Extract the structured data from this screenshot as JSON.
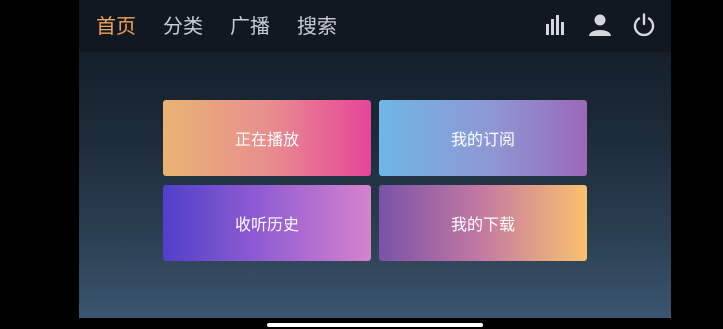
{
  "nav": {
    "tabs": [
      {
        "label": "首页",
        "active": true
      },
      {
        "label": "分类",
        "active": false
      },
      {
        "label": "广播",
        "active": false
      },
      {
        "label": "搜索",
        "active": false
      }
    ],
    "icons": [
      "bar-chart-icon",
      "user-icon",
      "power-icon"
    ]
  },
  "menu": {
    "items": [
      {
        "label": "正在播放"
      },
      {
        "label": "我的订阅"
      },
      {
        "label": "收听历史"
      },
      {
        "label": "我的下载"
      }
    ]
  },
  "colors": {
    "active_tab": "#f0a35a",
    "inactive_tab": "#c9ced6"
  }
}
